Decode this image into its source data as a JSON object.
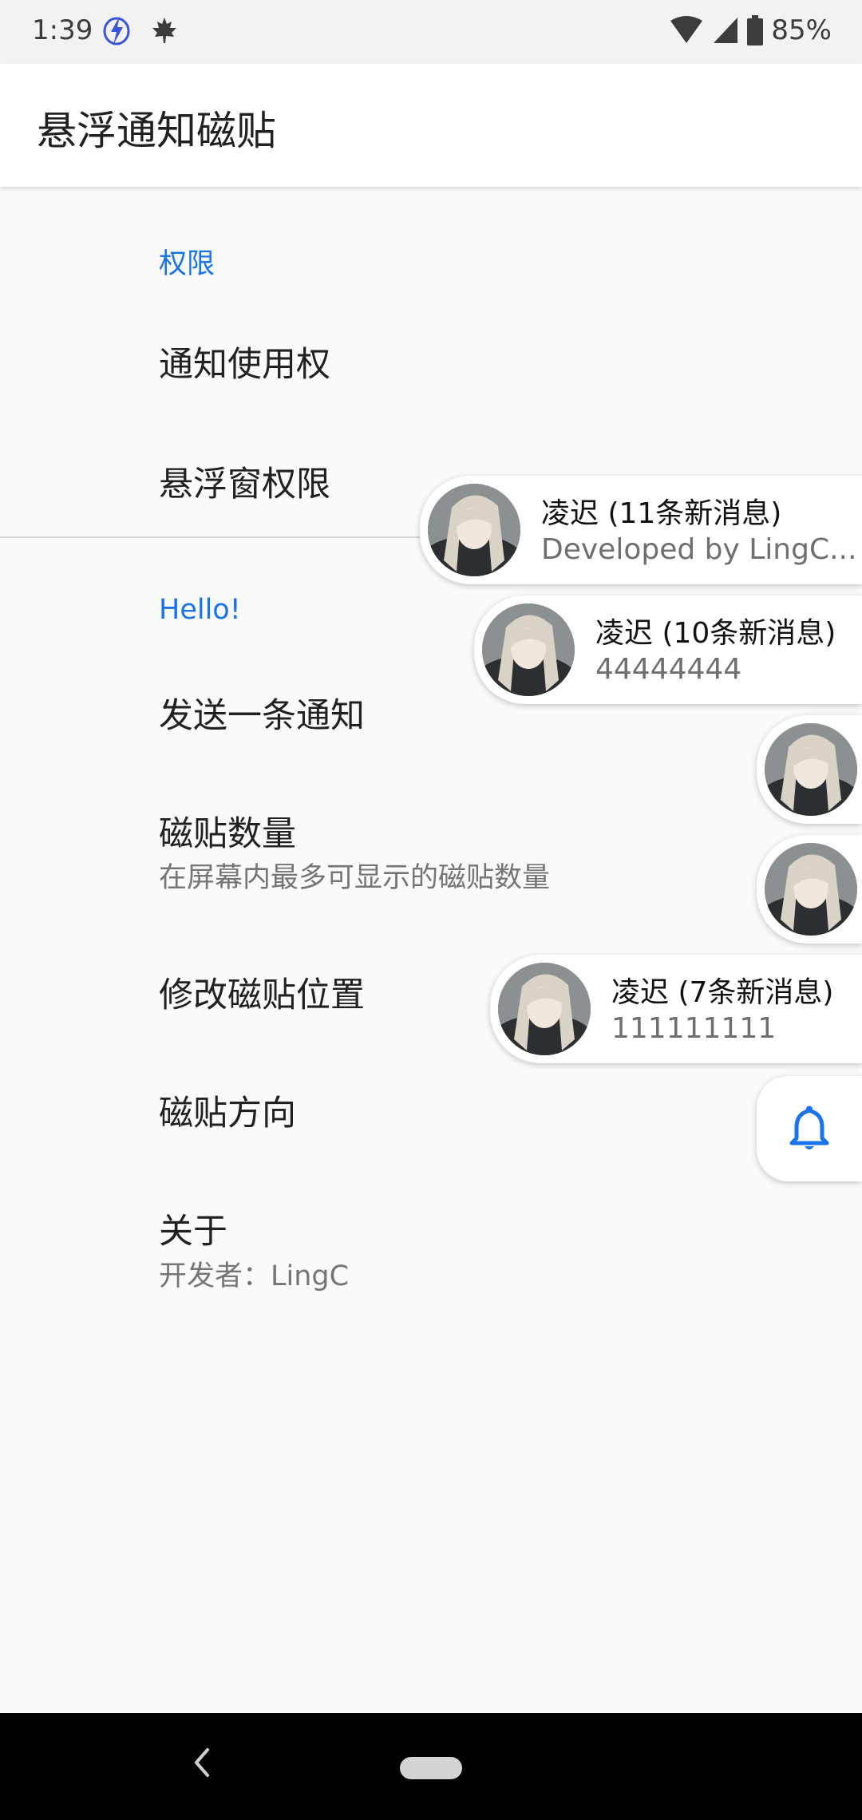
{
  "status_bar": {
    "time": "1:39",
    "battery": "85%",
    "icons": [
      "bolt-circle-icon",
      "maple-leaf-icon",
      "wifi-icon",
      "cell-signal-icon",
      "battery-icon"
    ]
  },
  "app_bar": {
    "title": "悬浮通知磁贴"
  },
  "sections": [
    {
      "header": "权限",
      "items": [
        {
          "title": "通知使用权"
        },
        {
          "title": "悬浮窗权限"
        }
      ]
    },
    {
      "header": "Hello!",
      "items": [
        {
          "title": "发送一条通知"
        },
        {
          "title": "磁贴数量",
          "summary": "在屏幕内最多可显示的磁贴数量"
        },
        {
          "title": "修改磁贴位置"
        },
        {
          "title": "磁贴方向"
        },
        {
          "title": "关于",
          "summary": "开发者：LingC"
        }
      ]
    }
  ],
  "floating_tiles": [
    {
      "title": "凌迟 (11条新消息)",
      "text": "Developed by LingC..."
    },
    {
      "title": "凌迟 (10条新消息)",
      "text": "44444444"
    },
    {
      "title": "",
      "text": ""
    },
    {
      "title": "",
      "text": ""
    },
    {
      "title": "凌迟 (7条新消息)",
      "text": "111111111"
    }
  ],
  "bell_tile": {
    "icon": "bell-icon"
  },
  "colors": {
    "accent": "#1a73e8",
    "background": "#fafafa",
    "nav_bar": "#000000"
  },
  "nav_bar": {
    "icons": [
      "back-icon",
      "home-pill-icon"
    ]
  }
}
